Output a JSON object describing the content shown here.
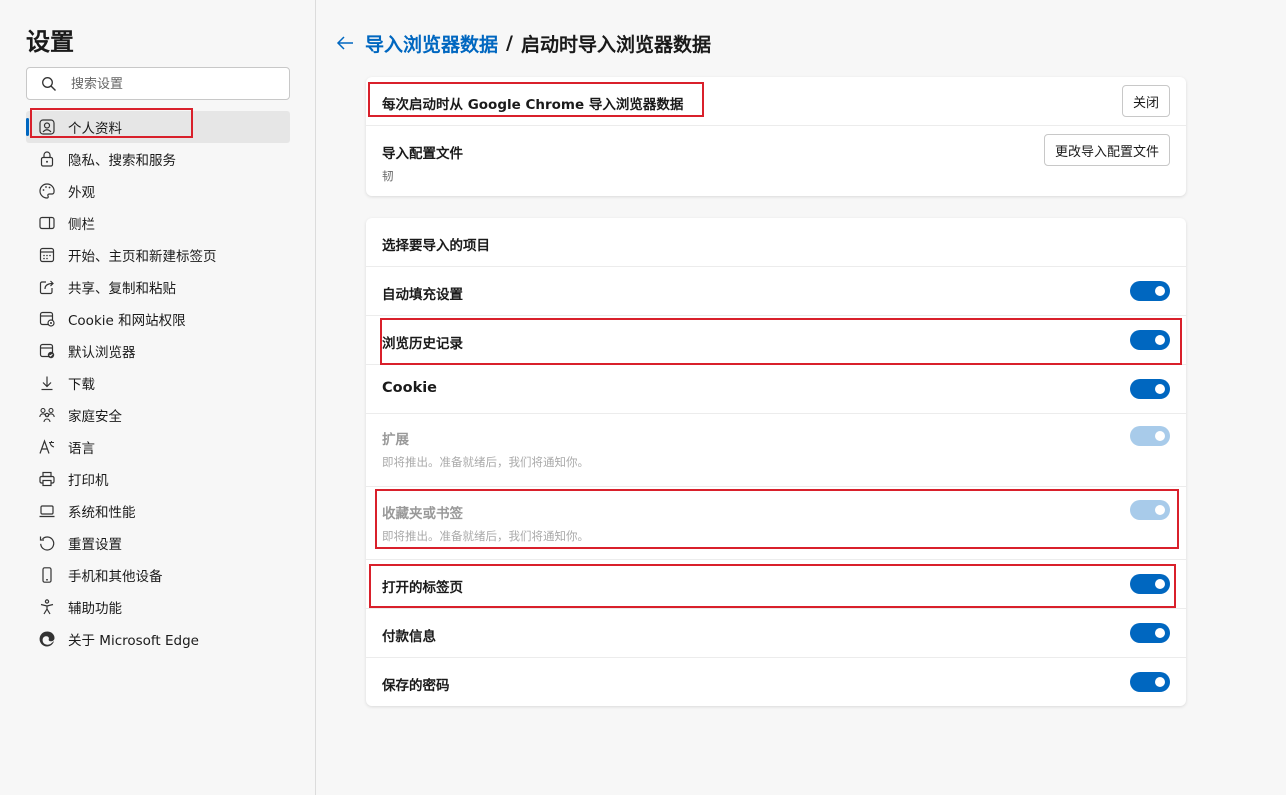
{
  "sidebar": {
    "title": "设置",
    "search_placeholder": "搜索设置",
    "items": [
      {
        "label": "个人资料",
        "icon": "profile-icon"
      },
      {
        "label": "隐私、搜索和服务",
        "icon": "lock-icon"
      },
      {
        "label": "外观",
        "icon": "palette-icon"
      },
      {
        "label": "侧栏",
        "icon": "sidebar-icon"
      },
      {
        "label": "开始、主页和新建标签页",
        "icon": "home-grid-icon"
      },
      {
        "label": "共享、复制和粘贴",
        "icon": "share-icon"
      },
      {
        "label": "Cookie 和网站权限",
        "icon": "site-permissions-icon"
      },
      {
        "label": "默认浏览器",
        "icon": "default-browser-icon"
      },
      {
        "label": "下载",
        "icon": "download-icon"
      },
      {
        "label": "家庭安全",
        "icon": "family-icon"
      },
      {
        "label": "语言",
        "icon": "language-icon"
      },
      {
        "label": "打印机",
        "icon": "printer-icon"
      },
      {
        "label": "系统和性能",
        "icon": "laptop-icon"
      },
      {
        "label": "重置设置",
        "icon": "reset-icon"
      },
      {
        "label": "手机和其他设备",
        "icon": "phone-icon"
      },
      {
        "label": "辅助功能",
        "icon": "accessibility-icon"
      },
      {
        "label": "关于 Microsoft Edge",
        "icon": "edge-logo-icon"
      }
    ]
  },
  "header": {
    "breadcrumb_parent": "导入浏览器数据",
    "separator": "/",
    "breadcrumb_current": "启动时导入浏览器数据"
  },
  "card1": {
    "startup_import_label": "每次启动时从 Google Chrome 导入浏览器数据",
    "close_button": "关闭",
    "import_profile_label": "导入配置文件",
    "import_profile_value": "韧",
    "change_profile_button": "更改导入配置文件"
  },
  "card2": {
    "section_title": "选择要导入的项目",
    "items": [
      {
        "label": "自动填充设置",
        "sub": "",
        "on": true,
        "disabled": false
      },
      {
        "label": "浏览历史记录",
        "sub": "",
        "on": true,
        "disabled": false
      },
      {
        "label": "Cookie",
        "sub": "",
        "on": true,
        "disabled": false
      },
      {
        "label": "扩展",
        "sub": "即将推出。准备就绪后，我们将通知你。",
        "on": true,
        "disabled": true
      },
      {
        "label": "收藏夹或书签",
        "sub": "即将推出。准备就绪后，我们将通知你。",
        "on": true,
        "disabled": true
      },
      {
        "label": "打开的标签页",
        "sub": "",
        "on": true,
        "disabled": false
      },
      {
        "label": "付款信息",
        "sub": "",
        "on": true,
        "disabled": false
      },
      {
        "label": "保存的密码",
        "sub": "",
        "on": true,
        "disabled": false
      }
    ]
  },
  "colors": {
    "accent": "#0067c0",
    "highlight": "#d9202b",
    "toggle_disabled": "#a8cbea"
  }
}
